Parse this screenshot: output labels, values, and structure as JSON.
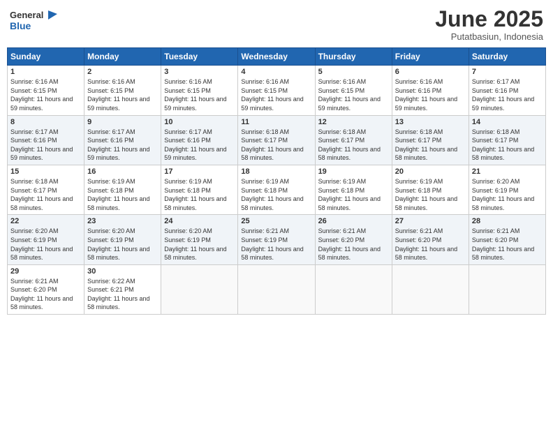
{
  "logo": {
    "line1": "General",
    "line2": "Blue"
  },
  "title": "June 2025",
  "subtitle": "Putatbasiun, Indonesia",
  "weekdays": [
    "Sunday",
    "Monday",
    "Tuesday",
    "Wednesday",
    "Thursday",
    "Friday",
    "Saturday"
  ],
  "weeks": [
    [
      {
        "day": 1,
        "sunrise": "6:16 AM",
        "sunset": "6:15 PM",
        "daylight": "11 hours and 59 minutes."
      },
      {
        "day": 2,
        "sunrise": "6:16 AM",
        "sunset": "6:15 PM",
        "daylight": "11 hours and 59 minutes."
      },
      {
        "day": 3,
        "sunrise": "6:16 AM",
        "sunset": "6:15 PM",
        "daylight": "11 hours and 59 minutes."
      },
      {
        "day": 4,
        "sunrise": "6:16 AM",
        "sunset": "6:15 PM",
        "daylight": "11 hours and 59 minutes."
      },
      {
        "day": 5,
        "sunrise": "6:16 AM",
        "sunset": "6:15 PM",
        "daylight": "11 hours and 59 minutes."
      },
      {
        "day": 6,
        "sunrise": "6:16 AM",
        "sunset": "6:16 PM",
        "daylight": "11 hours and 59 minutes."
      },
      {
        "day": 7,
        "sunrise": "6:17 AM",
        "sunset": "6:16 PM",
        "daylight": "11 hours and 59 minutes."
      }
    ],
    [
      {
        "day": 8,
        "sunrise": "6:17 AM",
        "sunset": "6:16 PM",
        "daylight": "11 hours and 59 minutes."
      },
      {
        "day": 9,
        "sunrise": "6:17 AM",
        "sunset": "6:16 PM",
        "daylight": "11 hours and 59 minutes."
      },
      {
        "day": 10,
        "sunrise": "6:17 AM",
        "sunset": "6:16 PM",
        "daylight": "11 hours and 59 minutes."
      },
      {
        "day": 11,
        "sunrise": "6:18 AM",
        "sunset": "6:17 PM",
        "daylight": "11 hours and 58 minutes."
      },
      {
        "day": 12,
        "sunrise": "6:18 AM",
        "sunset": "6:17 PM",
        "daylight": "11 hours and 58 minutes."
      },
      {
        "day": 13,
        "sunrise": "6:18 AM",
        "sunset": "6:17 PM",
        "daylight": "11 hours and 58 minutes."
      },
      {
        "day": 14,
        "sunrise": "6:18 AM",
        "sunset": "6:17 PM",
        "daylight": "11 hours and 58 minutes."
      }
    ],
    [
      {
        "day": 15,
        "sunrise": "6:18 AM",
        "sunset": "6:17 PM",
        "daylight": "11 hours and 58 minutes."
      },
      {
        "day": 16,
        "sunrise": "6:19 AM",
        "sunset": "6:18 PM",
        "daylight": "11 hours and 58 minutes."
      },
      {
        "day": 17,
        "sunrise": "6:19 AM",
        "sunset": "6:18 PM",
        "daylight": "11 hours and 58 minutes."
      },
      {
        "day": 18,
        "sunrise": "6:19 AM",
        "sunset": "6:18 PM",
        "daylight": "11 hours and 58 minutes."
      },
      {
        "day": 19,
        "sunrise": "6:19 AM",
        "sunset": "6:18 PM",
        "daylight": "11 hours and 58 minutes."
      },
      {
        "day": 20,
        "sunrise": "6:19 AM",
        "sunset": "6:18 PM",
        "daylight": "11 hours and 58 minutes."
      },
      {
        "day": 21,
        "sunrise": "6:20 AM",
        "sunset": "6:19 PM",
        "daylight": "11 hours and 58 minutes."
      }
    ],
    [
      {
        "day": 22,
        "sunrise": "6:20 AM",
        "sunset": "6:19 PM",
        "daylight": "11 hours and 58 minutes."
      },
      {
        "day": 23,
        "sunrise": "6:20 AM",
        "sunset": "6:19 PM",
        "daylight": "11 hours and 58 minutes."
      },
      {
        "day": 24,
        "sunrise": "6:20 AM",
        "sunset": "6:19 PM",
        "daylight": "11 hours and 58 minutes."
      },
      {
        "day": 25,
        "sunrise": "6:21 AM",
        "sunset": "6:19 PM",
        "daylight": "11 hours and 58 minutes."
      },
      {
        "day": 26,
        "sunrise": "6:21 AM",
        "sunset": "6:20 PM",
        "daylight": "11 hours and 58 minutes."
      },
      {
        "day": 27,
        "sunrise": "6:21 AM",
        "sunset": "6:20 PM",
        "daylight": "11 hours and 58 minutes."
      },
      {
        "day": 28,
        "sunrise": "6:21 AM",
        "sunset": "6:20 PM",
        "daylight": "11 hours and 58 minutes."
      }
    ],
    [
      {
        "day": 29,
        "sunrise": "6:21 AM",
        "sunset": "6:20 PM",
        "daylight": "11 hours and 58 minutes."
      },
      {
        "day": 30,
        "sunrise": "6:22 AM",
        "sunset": "6:21 PM",
        "daylight": "11 hours and 58 minutes."
      },
      null,
      null,
      null,
      null,
      null
    ]
  ]
}
